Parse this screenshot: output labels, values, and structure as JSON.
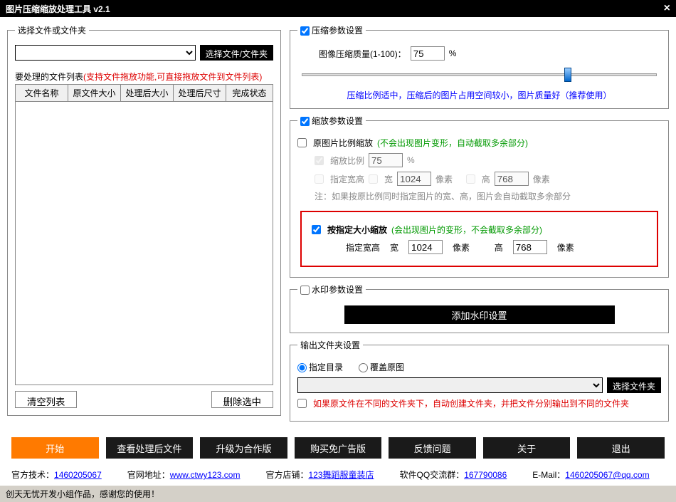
{
  "titlebar": {
    "title": "图片压缩缩放处理工具 v2.1"
  },
  "left": {
    "legend": "选择文件或文件夹",
    "select_btn": "选择文件/文件夹",
    "list_label": "要处理的文件列表",
    "list_hint": "(支持文件拖放功能,可直接拖放文件到文件列表)",
    "cols": {
      "c1": "文件名称",
      "c2": "原文件大小",
      "c3": "处理后大小",
      "c4": "处理后尺寸",
      "c5": "完成状态"
    },
    "clear_btn": "清空列表",
    "del_btn": "删除选中"
  },
  "compress": {
    "legend": "压缩参数设置",
    "quality_label": "图像压缩质量(1-100)：",
    "quality_value": "75",
    "quality_unit": "%",
    "slider_caption": "压缩比例适中，压缩后的图片占用空间较小，图片质量好（推荐使用）"
  },
  "scale": {
    "legend": "缩放参数设置",
    "prop_label": "原图片比例缩放",
    "prop_hint": "(不会出现图片变形，自动截取多余部分)",
    "ratio_label": "缩放比例",
    "ratio_value": "75",
    "ratio_unit": "%",
    "wh_label": "指定宽高",
    "w_label": "宽",
    "w_value": "1024",
    "h_label": "高",
    "h_value": "768",
    "px": "像素",
    "note": "注：如果按原比例同时指定图片的宽、高，图片会自动截取多余部分",
    "size_label": "按指定大小缩放",
    "size_hint": "(会出现图片的变形，不会截取多余部分)",
    "size_wh": "指定宽高",
    "sw_label": "宽",
    "sw_value": "1024",
    "sh_label": "高",
    "sh_value": "768"
  },
  "watermark": {
    "legend": "水印参数设置",
    "btn": "添加水印设置"
  },
  "output": {
    "legend": "输出文件夹设置",
    "r1": "指定目录",
    "r2": "覆盖原图",
    "select_btn": "选择文件夹",
    "hint": "如果原文件在不同的文件夹下，自动创建文件夹，并把文件分别输出到不同的文件夹"
  },
  "bottom": {
    "b1": "开始",
    "b2": "查看处理后文件",
    "b3": "升级为合作版",
    "b4": "购买免广告版",
    "b5": "反馈问题",
    "b6": "关于",
    "b7": "退出"
  },
  "footer": {
    "f1a": "官方技术：",
    "f1b": "1460205067",
    "f2a": "官网地址：",
    "f2b": "www.ctwy123.com",
    "f3a": "官方店铺：",
    "f3b": "123舞蹈服童装店",
    "f4a": "软件QQ交流群：",
    "f4b": "167790086",
    "f5a": "E-Mail：",
    "f5b": "1460205067@qq.com"
  },
  "status": "创天无忧开发小组作品，感谢您的使用！"
}
